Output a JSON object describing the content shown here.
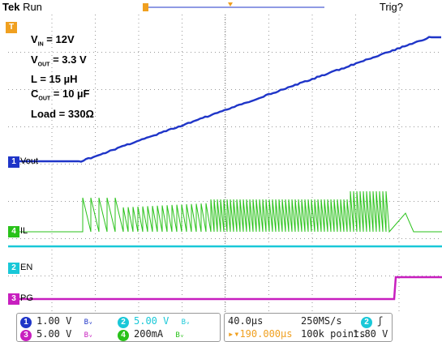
{
  "header": {
    "brand": "Tek",
    "status": "Run",
    "trigger_status": "Trig?"
  },
  "annotations": [
    {
      "main": "V",
      "sub": "IN",
      "rest": " = 12V"
    },
    {
      "main": "V",
      "sub": "OUT",
      "rest": " = 3.3 V"
    },
    {
      "main": "L = 15 µH",
      "sub": "",
      "rest": ""
    },
    {
      "main": "C",
      "sub": "OUT",
      "rest": " = 10 µF"
    },
    {
      "main": "Load = 330Ω",
      "sub": "",
      "rest": ""
    }
  ],
  "channels": {
    "ch1": {
      "number": "1",
      "label": "Vout",
      "color": "#1f35c8",
      "scale": "1.00 V"
    },
    "ch2": {
      "number": "2",
      "label": "EN",
      "color": "#19c8d8",
      "scale": "5.00 V"
    },
    "ch3": {
      "number": "3",
      "label": "PG",
      "color": "#c81fbf",
      "scale": "5.00 V"
    },
    "ch4": {
      "number": "4",
      "label": "IL",
      "color": "#29c21a",
      "scale": "200mA"
    }
  },
  "bw_symbol": "Bᵥ",
  "timebase": {
    "per_div": "40.0µs",
    "delay": "190.000µs",
    "sample_rate": "250MS/s",
    "record": "100k points"
  },
  "trigger": {
    "channel": "2",
    "slope": "ʃ",
    "level": "1.80 V"
  },
  "trigger_marker": "T",
  "colors": {
    "grid": "#888888",
    "vout": "#1f35c8",
    "il": "#29c21a",
    "en": "#19c8d8",
    "pg": "#c81fbf",
    "trigger_orange": "#f0a020"
  }
}
